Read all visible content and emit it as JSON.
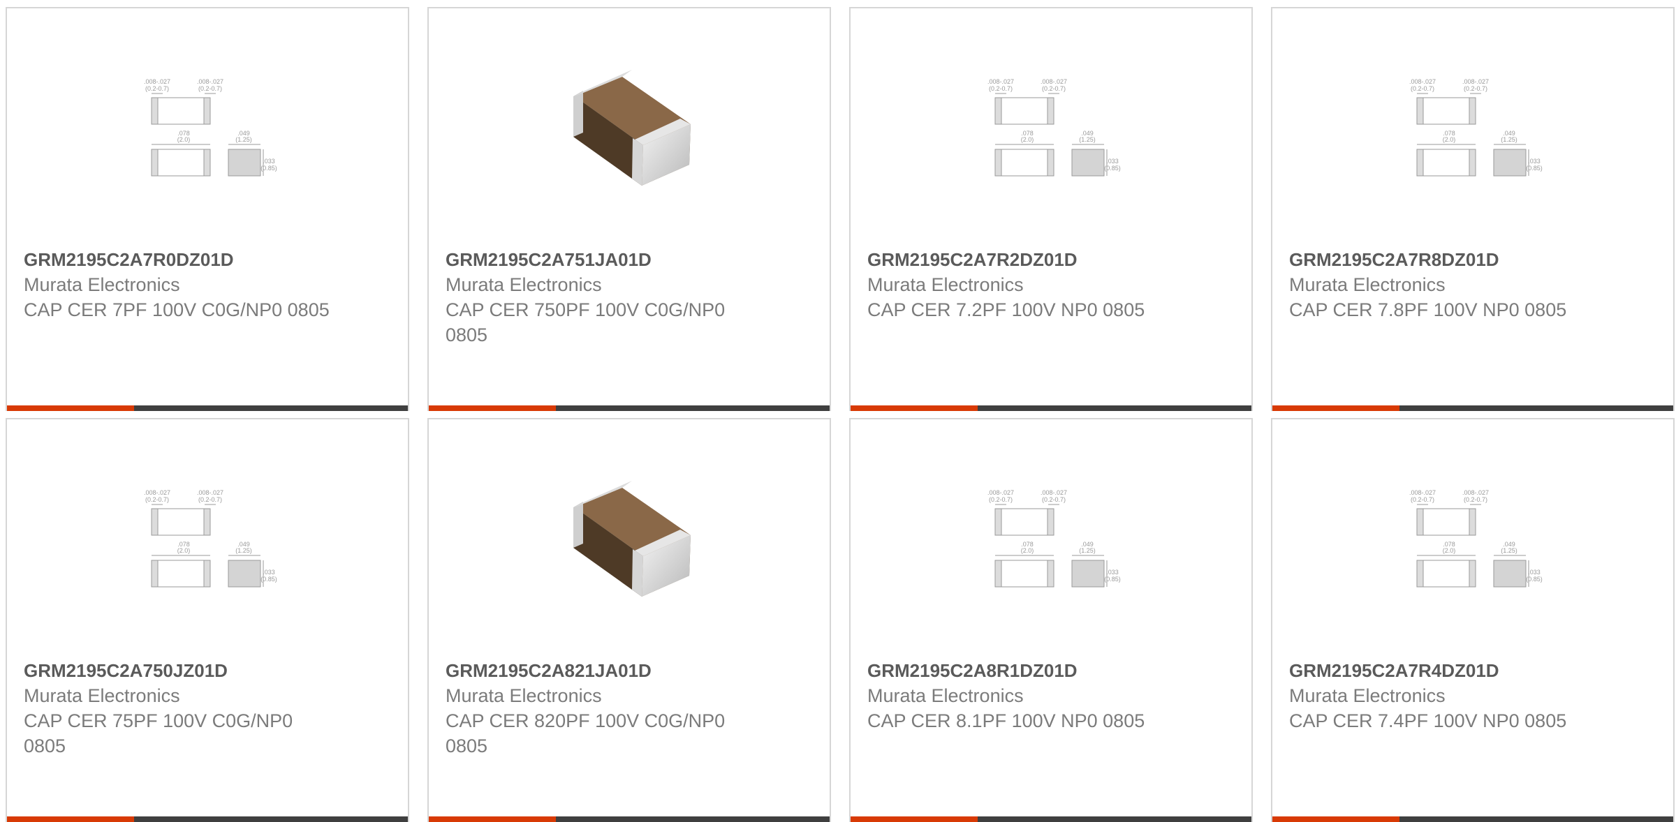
{
  "colors": {
    "accent": "#d83a05",
    "bar": "#3f3f3f",
    "border": "#d6d6d6",
    "title": "#5a5a5a",
    "text": "#7b7b7b"
  },
  "products": [
    {
      "part_number": "GRM2195C2A7R0DZ01D",
      "manufacturer": "Murata Electronics",
      "description": "CAP CER 7PF 100V C0G/NP0 0805",
      "image": "dimension-drawing"
    },
    {
      "part_number": "GRM2195C2A751JA01D",
      "manufacturer": "Murata Electronics",
      "description": "CAP CER 750PF 100V C0G/NP0 0805",
      "image": "capacitor-photo"
    },
    {
      "part_number": "GRM2195C2A7R2DZ01D",
      "manufacturer": "Murata Electronics",
      "description": "CAP CER 7.2PF 100V NP0 0805",
      "image": "dimension-drawing"
    },
    {
      "part_number": "GRM2195C2A7R8DZ01D",
      "manufacturer": "Murata Electronics",
      "description": "CAP CER 7.8PF 100V NP0 0805",
      "image": "dimension-drawing"
    },
    {
      "part_number": "GRM2195C2A750JZ01D",
      "manufacturer": "Murata Electronics",
      "description": "CAP CER 75PF 100V C0G/NP0 0805",
      "image": "dimension-drawing"
    },
    {
      "part_number": "GRM2195C2A821JA01D",
      "manufacturer": "Murata Electronics",
      "description": "CAP CER 820PF 100V C0G/NP0 0805",
      "image": "capacitor-photo"
    },
    {
      "part_number": "GRM2195C2A8R1DZ01D",
      "manufacturer": "Murata Electronics",
      "description": "CAP CER 8.1PF 100V NP0 0805",
      "image": "dimension-drawing"
    },
    {
      "part_number": "GRM2195C2A7R4DZ01D",
      "manufacturer": "Murata Electronics",
      "description": "CAP CER 7.4PF 100V NP0 0805",
      "image": "dimension-drawing"
    }
  ],
  "dimension_drawing": {
    "terminal_dim": ".008-.027",
    "terminal_dim_mm": "(0.2-0.7)",
    "length": ".078",
    "length_mm": "(2.0)",
    "width": ".049",
    "width_mm": "(1.25)",
    "thickness": ".033",
    "thickness_mm": "(0.85)"
  }
}
